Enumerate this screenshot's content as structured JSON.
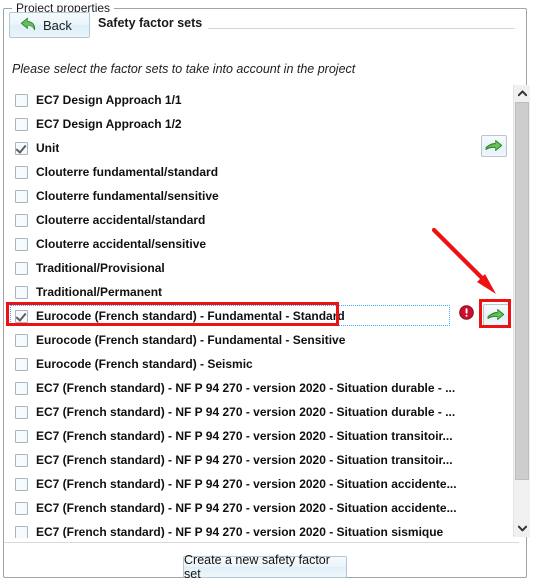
{
  "groupbox": {
    "title": "Project properties"
  },
  "header": {
    "back_label": "Back",
    "back_icon": "back-arrow-icon",
    "title": "Safety factor sets"
  },
  "instruction": "Please select the factor sets to take into account in the project",
  "list": {
    "rows": [
      {
        "label": "EC7 Design Approach 1/1",
        "checked": false
      },
      {
        "label": "EC7 Design Approach 1/2",
        "checked": false
      },
      {
        "label": "Unit",
        "checked": true
      },
      {
        "label": "Clouterre fundamental/standard",
        "checked": false
      },
      {
        "label": "Clouterre fundamental/sensitive",
        "checked": false
      },
      {
        "label": "Clouterre accidental/standard",
        "checked": false
      },
      {
        "label": "Clouterre accidental/sensitive",
        "checked": false
      },
      {
        "label": "Traditional/Provisional",
        "checked": false
      },
      {
        "label": "Traditional/Permanent",
        "checked": false
      },
      {
        "label": "Eurocode (French standard) - Fundamental - Standard",
        "checked": true
      },
      {
        "label": "Eurocode (French standard) - Fundamental - Sensitive",
        "checked": false
      },
      {
        "label": "Eurocode (French standard) - Seismic",
        "checked": false
      },
      {
        "label": "EC7 (French standard) - NF P 94 270 - version 2020 - Situation durable - ...",
        "checked": false
      },
      {
        "label": "EC7 (French standard) - NF P 94 270 - version 2020 - Situation durable - ...",
        "checked": false
      },
      {
        "label": "EC7 (French standard) - NF P 94 270 - version 2020 - Situation transitoir...",
        "checked": false
      },
      {
        "label": "EC7 (French standard) - NF P 94 270 - version 2020 - Situation transitoir...",
        "checked": false
      },
      {
        "label": "EC7 (French standard) - NF P 94 270 - version 2020 - Situation accidente...",
        "checked": false
      },
      {
        "label": "EC7 (French standard) - NF P 94 270 - version 2020 - Situation accidente...",
        "checked": false
      },
      {
        "label": "EC7 (French standard) - NF P 94 270 - version 2020 - Situation sismique",
        "checked": false
      }
    ]
  },
  "side_actions": {
    "unit_arrow_icon": "green-right-arrow-icon",
    "eurocode_arrow_icon": "green-right-arrow-icon",
    "eurocode_error_icon": "error-exclamation-icon"
  },
  "scrollbar": {
    "up_icon": "chevron-up-icon",
    "down_icon": "chevron-down-icon"
  },
  "footer": {
    "create_label": "Create a new safety factor set"
  },
  "annotation": {
    "color": "#ee1111",
    "arrow_icon": "annotation-arrow-icon"
  },
  "colors": {
    "accent_green": "#3f9c35",
    "error_red": "#cc1111",
    "focus_blue": "#3fa9f5",
    "annotation_red": "#ee1111"
  }
}
